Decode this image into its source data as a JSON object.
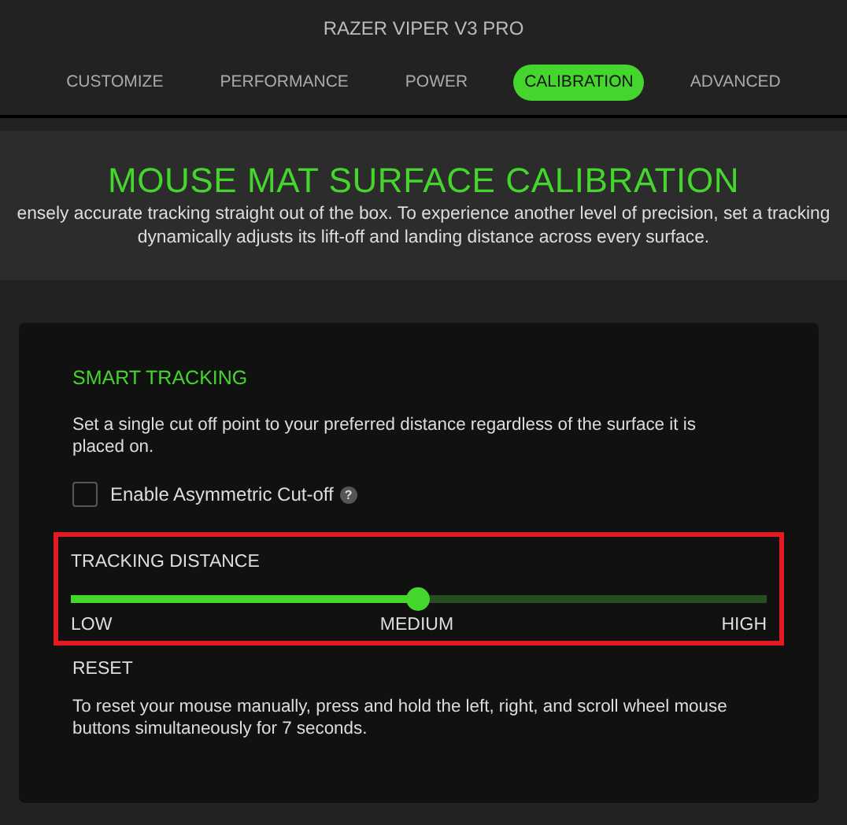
{
  "window": {
    "title": "RAZER VIPER V3 PRO"
  },
  "tabs": [
    {
      "label": "CUSTOMIZE",
      "selected": false
    },
    {
      "label": "PERFORMANCE",
      "selected": false
    },
    {
      "label": "POWER",
      "selected": false
    },
    {
      "label": "CALIBRATION",
      "selected": true
    },
    {
      "label": "ADVANCED",
      "selected": false
    }
  ],
  "banner": {
    "heading": "MOUSE MAT SURFACE CALIBRATION",
    "lines": [
      "ensely accurate tracking straight out of the box. To experience another level of precision, set a tracking",
      "dynamically adjusts its lift-off and landing distance across every surface."
    ]
  },
  "smart_tracking": {
    "heading": "SMART TRACKING",
    "description": "Set a single cut off point to your preferred distance regardless of the surface it is placed on.",
    "checkbox": {
      "label": "Enable Asymmetric Cut-off",
      "checked": false,
      "help": "?"
    },
    "tracking_distance": {
      "label": "TRACKING DISTANCE",
      "level": 0.5,
      "marks": [
        "LOW",
        "MEDIUM",
        "HIGH"
      ]
    },
    "reset": {
      "heading": "RESET",
      "description": "To reset your mouse manually, press and hold the left, right, and scroll wheel mouse buttons simultaneously for 7 seconds."
    }
  }
}
